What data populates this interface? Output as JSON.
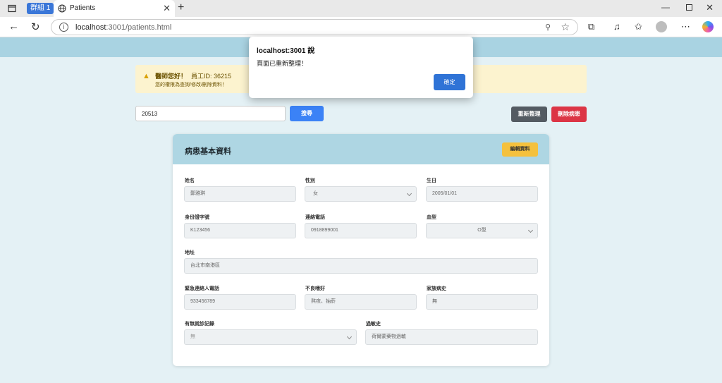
{
  "browser": {
    "tab_group_label": "群組 1",
    "tab_title": "Patients",
    "url_host": "localhost",
    "url_path": ":3001/patients.html"
  },
  "colors": {
    "header_band": "#a9d3e2",
    "page_bg": "#e4f1f5",
    "search_button": "#3b82f6",
    "refresh_button": "#545b62",
    "delete_button": "#dc3545",
    "edit_button": "#f5c13d",
    "warning_bg": "#fcf3cf"
  },
  "warning": {
    "greeting": "醫師您好！",
    "employee_id": "員工ID: 36215",
    "permission": "您的權限為查詢/修改/刪除資料！"
  },
  "search": {
    "value": "20513",
    "button_label": "搜尋"
  },
  "actions": {
    "refresh_label": "重新整理",
    "delete_label": "刪除病患"
  },
  "card": {
    "title": "病患基本資料",
    "edit_label": "編輯資料"
  },
  "fields": {
    "name": {
      "label": "姓名",
      "value": "鄭雅琪"
    },
    "gender": {
      "label": "性別",
      "value": "女"
    },
    "birthday": {
      "label": "生日",
      "value": "2005/01/01"
    },
    "id_number": {
      "label": "身份證字號",
      "value": "K123456"
    },
    "phone": {
      "label": "連絡電話",
      "value": "0918899001"
    },
    "blood_type": {
      "label": "血型",
      "value": "O型"
    },
    "address": {
      "label": "地址",
      "value": "台北市南港區"
    },
    "emergency_phone": {
      "label": "緊急連絡人電話",
      "value": "933456789"
    },
    "bad_habits": {
      "label": "不良嗜好",
      "value": "熬夜、抽菸"
    },
    "family_history": {
      "label": "家族病史",
      "value": "無"
    },
    "visit_record": {
      "label": "有無就診記錄",
      "value": "無"
    },
    "allergy": {
      "label": "過敏史",
      "value": "荷爾蒙藥物過敏"
    }
  },
  "dialog": {
    "title": "localhost:3001 說",
    "message": "頁面已重新整理！",
    "ok_label": "確定"
  }
}
